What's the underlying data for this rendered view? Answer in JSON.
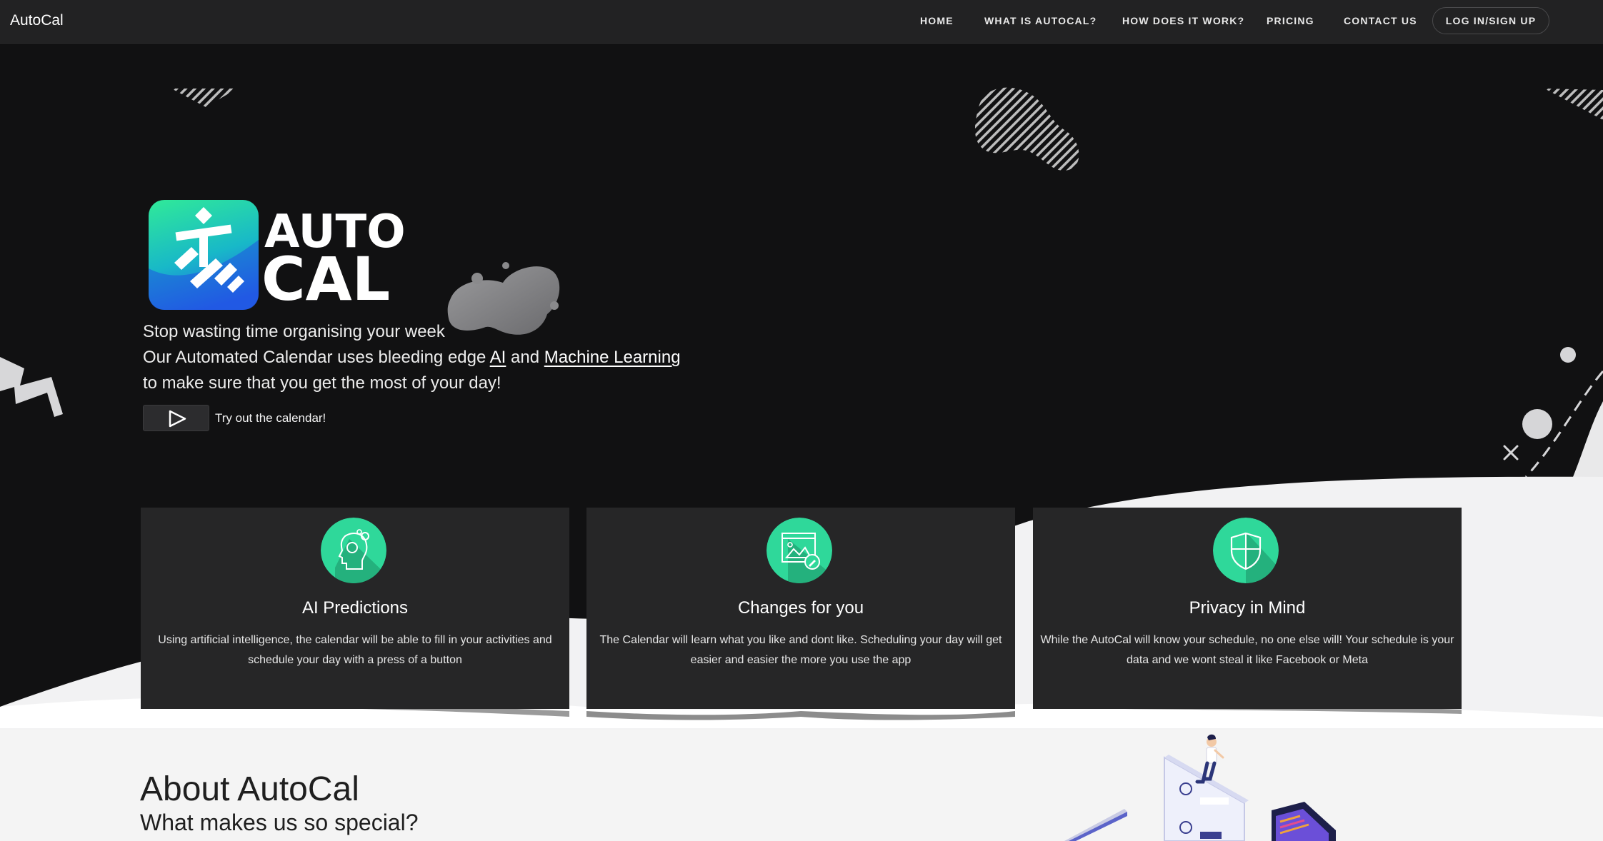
{
  "navbar": {
    "brand": "AutoCal",
    "links": [
      {
        "label": "HOME"
      },
      {
        "label": "WHAT IS AUTOCAL?"
      },
      {
        "label": "HOW DOES IT WORK?"
      },
      {
        "label": "PRICING"
      },
      {
        "label": "CONTACT US"
      }
    ],
    "login_label": "LOG IN/SIGN UP"
  },
  "hero": {
    "logo_line1": "AUTO",
    "logo_line2": "CAL",
    "line1": "Stop wasting time organising your week",
    "line2_before": "Our Automated Calendar uses bleeding edge ",
    "link_ai": "AI",
    "line2_mid": " and ",
    "link_ml": "Machine Learning",
    "line3": "to make sure that you get the most of your day!",
    "try_label": "Try out the calendar!",
    "play_icon": "play-icon"
  },
  "features": [
    {
      "icon": "ai-brain-icon",
      "title": "AI Predictions",
      "description": "Using artificial intelligence, the calendar will be able to fill in your activities and schedule your day with a press of a button"
    },
    {
      "icon": "edit-window-icon",
      "title": "Changes for you",
      "description": "The Calendar will learn what you like and dont like. Scheduling your day will get easier and easier the more you use the app"
    },
    {
      "icon": "shield-icon",
      "title": "Privacy in Mind",
      "description": "While the AutoCal will know your schedule, no one else will! Your schedule is your data and we wont steal it like Facebook or Meta"
    }
  ],
  "about": {
    "title": "About AutoCal",
    "subtitle": "What makes us so special?"
  },
  "colors": {
    "navbar_bg": "#222223",
    "hero_bg": "#111112",
    "card_bg": "#262627",
    "accent_green": "#2fd89a",
    "logo_gradient_top": "#2ee59d",
    "logo_gradient_bottom": "#2563eb",
    "light_section_bg": "#f4f4f4"
  }
}
